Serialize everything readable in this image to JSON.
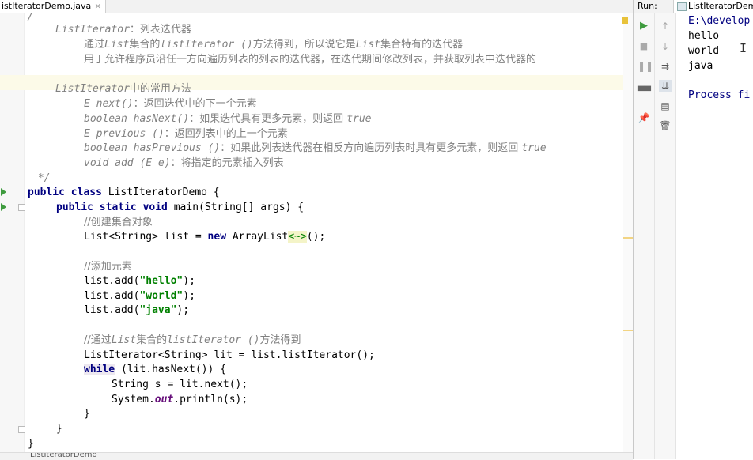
{
  "editor": {
    "tab_label": "istIteratorDemo.java",
    "close_glyph": "×",
    "bottom_label": "ListIteratorDemo",
    "lines": {
      "l0": "/",
      "l1_a": "ListIterator",
      "l1_b": "：列表迭代器",
      "l2_a": "通过",
      "l2_b": "List",
      "l2_c": "集合的",
      "l2_d": "listIterator ()",
      "l2_e": "方法得到，所以说它是",
      "l2_f": "List",
      "l2_g": "集合特有的迭代器",
      "l3": "用于允许程序员沿任一方向遍历列表的列表的迭代器，在迭代期间修改列表，并获取列表中迭代器的",
      "l5_a": "ListIterator",
      "l5_b": "中的常用方法",
      "l6_a": "E next()",
      "l6_b": "：返回迭代中的下一个元素",
      "l7_a": "boolean hasNext()",
      "l7_b": "：如果迭代具有更多元素，则返回 ",
      "l7_c": "true",
      "l8_a": "E previous ()",
      "l8_b": "：返回列表中的上一个元素",
      "l9_a": "boolean hasPrevious ()",
      "l9_b": "：如果此列表迭代器在相反方向遍历列表时具有更多元素，则返回 ",
      "l9_c": "true",
      "l10_a": "void add (E e)",
      "l10_b": "：将指定的元素插入列表",
      "l11": " */",
      "l12_kw": "public class",
      "l12_rest": " ListIteratorDemo {",
      "l13_kw": "public static void",
      "l13_rest": " main(String[] args) {",
      "l14": "//创建集合对象",
      "l15_a": "List<String> list = ",
      "l15_kw": "new",
      "l15_b": " ArrayList",
      "l15_dia": "<~>",
      "l15_c": "();",
      "l17": "//添加元素",
      "l18_a": "list.add(",
      "l18_s": "\"hello\"",
      "l18_b": ");",
      "l19_a": "list.add(",
      "l19_s": "\"world\"",
      "l19_b": ");",
      "l20_a": "list.add(",
      "l20_s": "\"java\"",
      "l20_b": ");",
      "l22_a": "//通过",
      "l22_b": "List",
      "l22_c": "集合的",
      "l22_d": "listIterator ()",
      "l22_e": "方法得到",
      "l23": "ListIterator<String> lit = list.listIterator();",
      "l24_kw": "while",
      "l24_rest": " (lit.hasNext()) {",
      "l25": "String s = lit.next();",
      "l26_a": "System.",
      "l26_out": "out",
      "l26_b": ".println(s);",
      "l27": "}",
      "l28": "}",
      "l29": "}"
    }
  },
  "run_panel": {
    "label": "Run:",
    "tab_label": "ListIteratorDem",
    "console_lines": [
      "E:\\develop",
      "hello",
      "world",
      "java",
      "",
      "Process fi"
    ],
    "toolbar_icons": [
      "run-icon",
      "stop-icon",
      "pause-icon",
      "layout-icon",
      "pin-icon",
      "up-arrow-icon",
      "down-arrow-icon",
      "soft-wrap-icon",
      "scroll-to-end-icon",
      "print-icon",
      "trash-icon"
    ]
  },
  "colors": {
    "keyword": "#000080",
    "string": "#008000",
    "comment": "#808080",
    "console_text": "#000080",
    "run_green": "#3e9b3e"
  }
}
